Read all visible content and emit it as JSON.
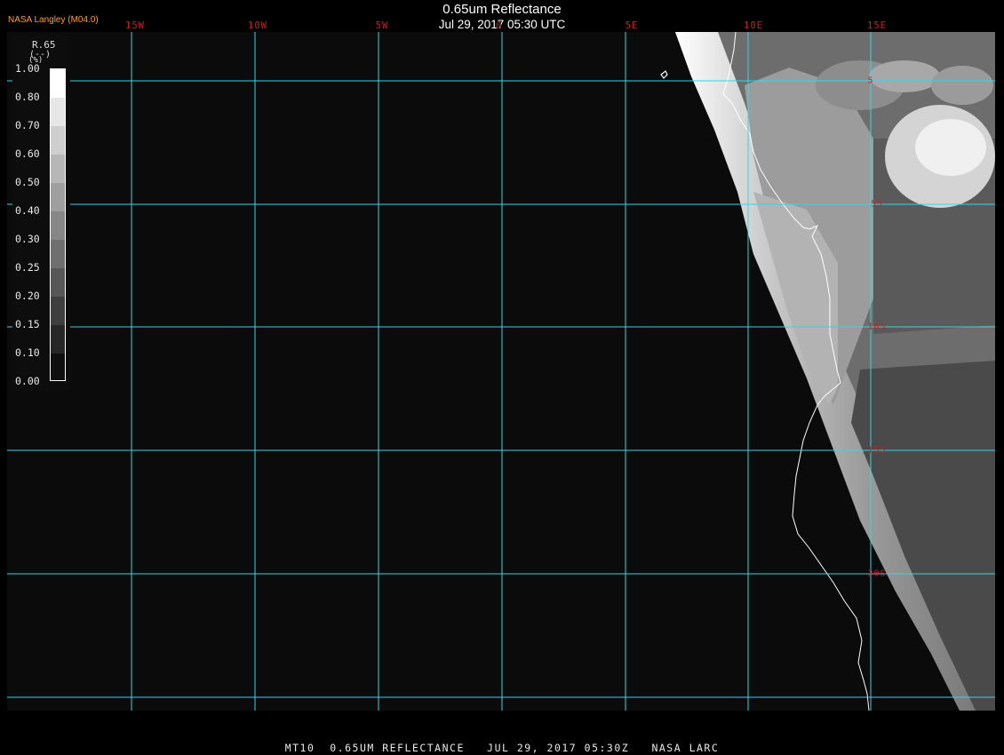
{
  "header": {
    "title": "0.65um Reflectance",
    "subtitle": "Jul 29, 2017 05:30 UTC",
    "agency": "NASA Langley (M04.0)"
  },
  "longitude_labels": [
    "15W",
    "10W",
    "5W",
    "0",
    "5E",
    "10E",
    "15E"
  ],
  "latitude_labels": [
    "5",
    "5S",
    "10S",
    "15S",
    "20S"
  ],
  "legend": {
    "name": "R.65",
    "unit": "(--)",
    "unit_small": "(%)",
    "ticks": [
      "1.00",
      "0.80",
      "0.70",
      "0.60",
      "0.50",
      "0.40",
      "0.30",
      "0.25",
      "0.20",
      "0.15",
      "0.10",
      "0.00"
    ]
  },
  "footer": "MT10  0.65UM REFLECTANCE   JUL 29, 2017 05:30Z   NASA LARC",
  "colors": {
    "grid": "#3bd3e6",
    "grid_labels": "#d11d1d",
    "agency_label": "#ff9d2e",
    "coastline": "#ffffff",
    "background": "#0b0b0b"
  }
}
